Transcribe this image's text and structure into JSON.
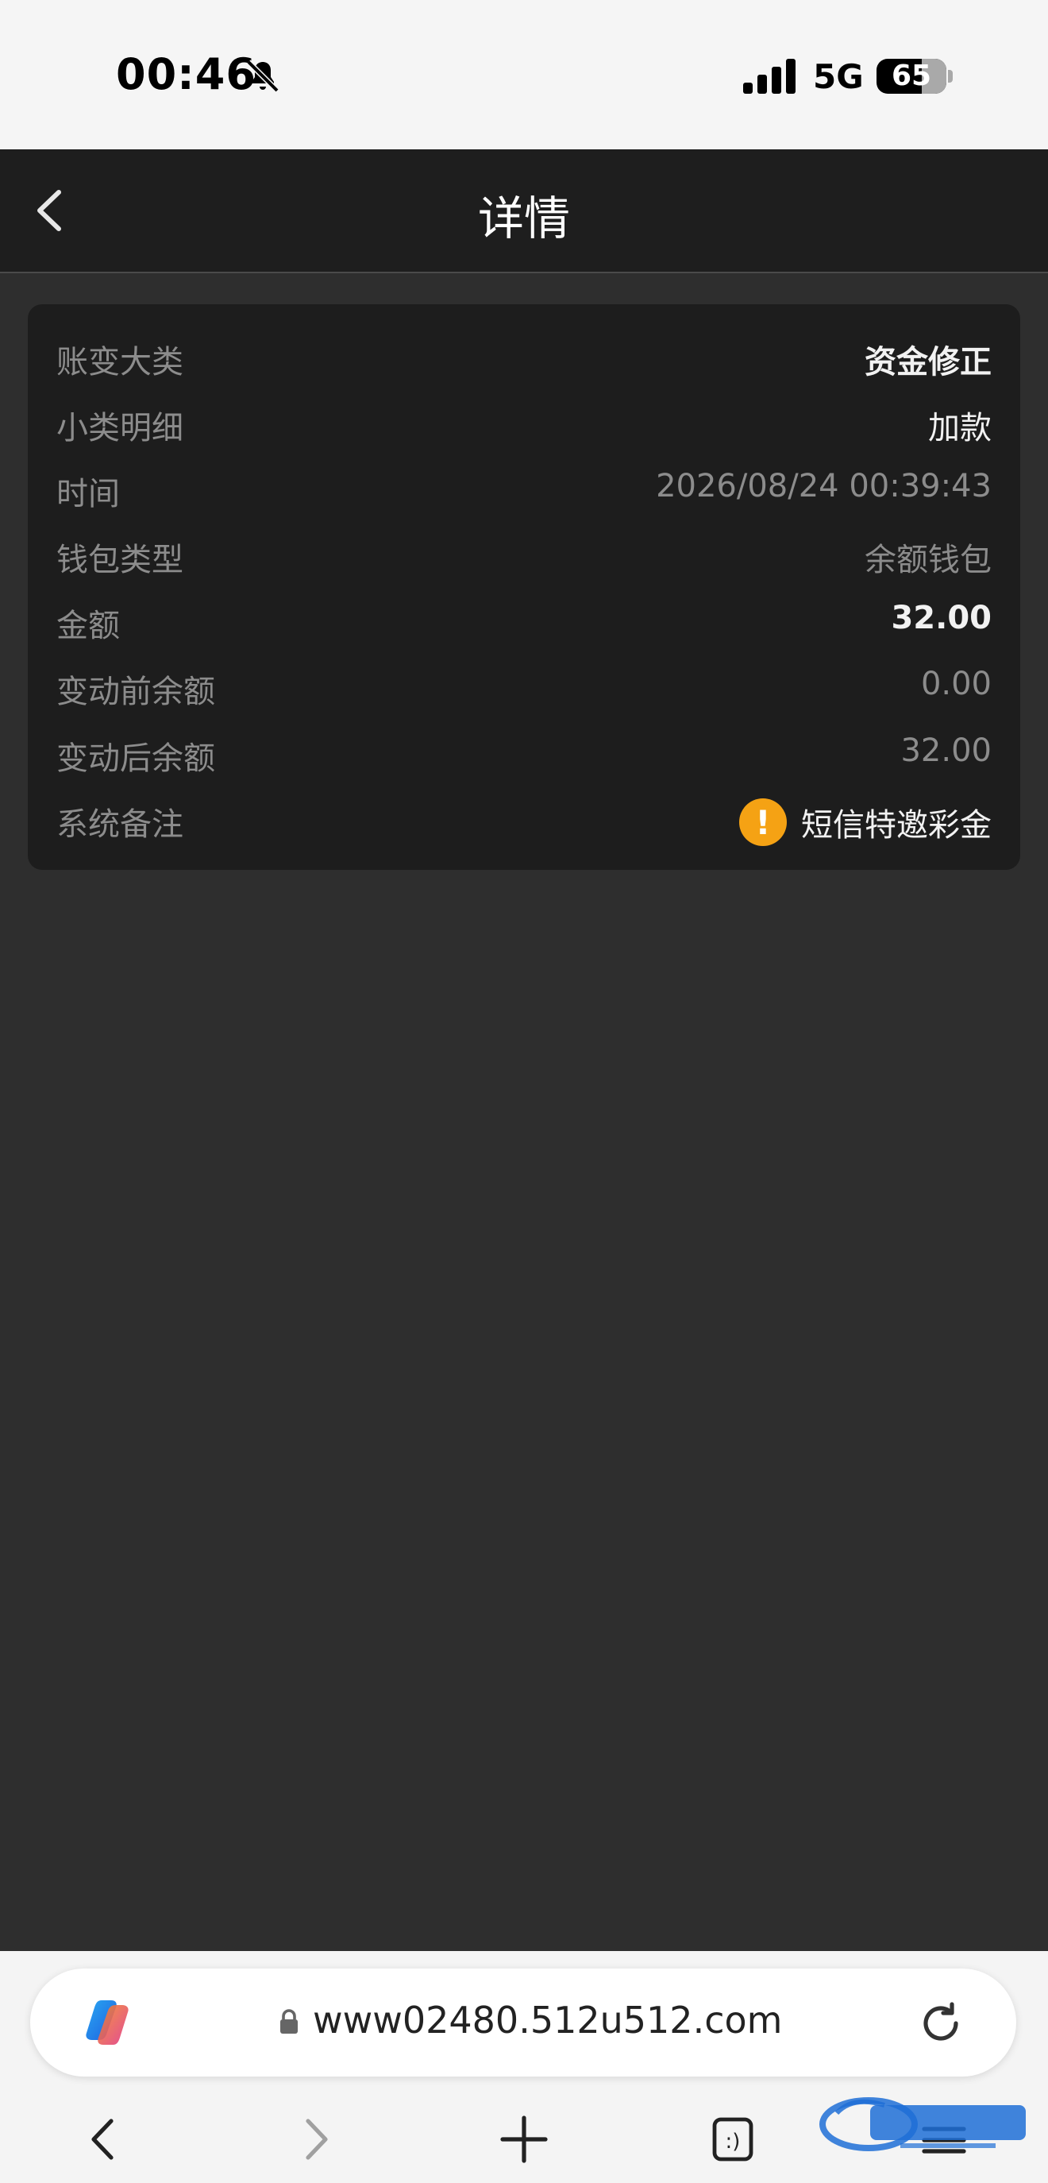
{
  "status": {
    "time": "00:46",
    "network": "5G",
    "battery": "65",
    "battery_level": 0.65
  },
  "header": {
    "title": "详情"
  },
  "rows": [
    {
      "label": "账变大类",
      "value": "资金修正"
    },
    {
      "label": "小类明细",
      "value": "加款"
    },
    {
      "label": "时间",
      "value": "2026/08/24 00:39:43"
    },
    {
      "label": "钱包类型",
      "value": "余额钱包"
    },
    {
      "label": "金额",
      "value": "32.00"
    },
    {
      "label": "变动前余额",
      "value": "0.00"
    },
    {
      "label": "变动后余额",
      "value": "32.00"
    },
    {
      "label": "系统备注",
      "value": "短信特邀彩金",
      "icon": "!"
    }
  ],
  "browser": {
    "url": "www02480.512u512.com",
    "tabs_glyph": ":)"
  },
  "colors": {
    "accent": "#f5a214",
    "card": "#1d1d1d",
    "page": "#2e2e2e",
    "header": "#1e1e1e"
  }
}
